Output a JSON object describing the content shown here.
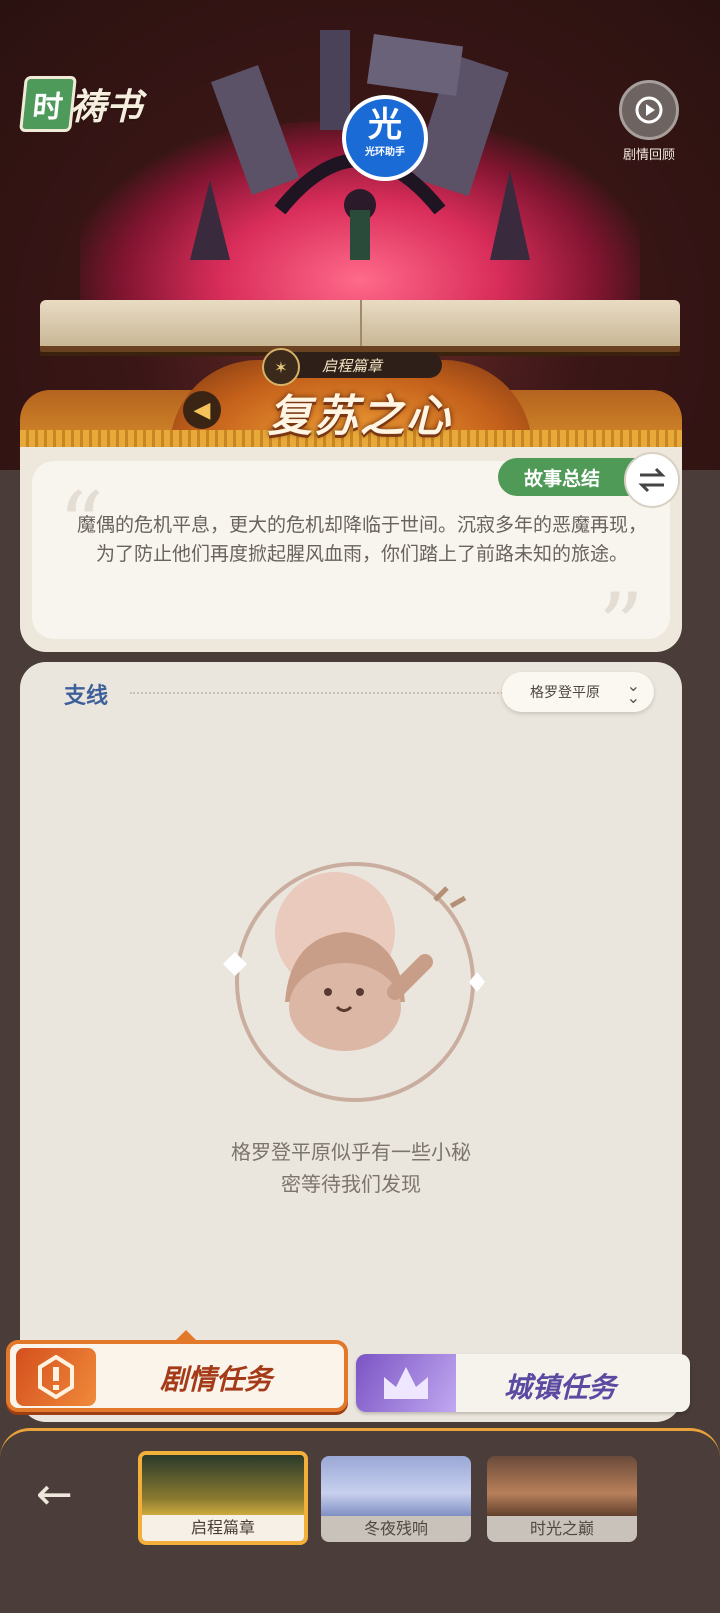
{
  "header": {
    "logo_mark": "时",
    "logo_text": "祷书",
    "replay_label": "剧情回顾",
    "assistant_big": "光",
    "assistant_small": "光环助手"
  },
  "chapter": {
    "label": "启程篇章",
    "title": "复苏之心"
  },
  "summary": {
    "tag": "故事总结",
    "text": "魔偶的危机平息，更大的危机却降临于世间。沉寂多年的恶魔再现，为了防止他们再度掀起腥风血雨，你们踏上了前路未知的旅途。"
  },
  "side_quests": {
    "title": "支线",
    "region": "格罗登平原",
    "empty_line1": "格罗登平原似乎有一些小秘",
    "empty_line2": "密等待我们发现"
  },
  "quest_tabs": {
    "story": "剧情任务",
    "town": "城镇任务"
  },
  "chapters": [
    {
      "name": "启程篇章",
      "active": true
    },
    {
      "name": "冬夜残响",
      "active": false
    },
    {
      "name": "时光之巅",
      "active": false
    }
  ],
  "colors": {
    "accent_orange": "#e2782a",
    "summary_green": "#4f9a57",
    "side_title_blue": "#3d5f9a",
    "town_purple": "#7b54c4"
  }
}
